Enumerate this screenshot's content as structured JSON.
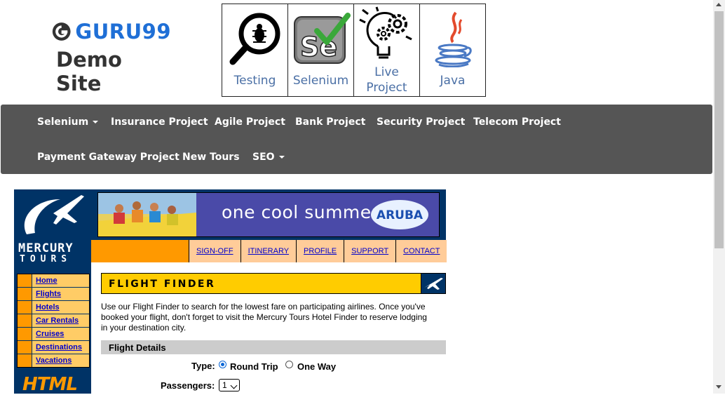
{
  "brand": {
    "name": "GURU99",
    "subtitle": "Demo Site"
  },
  "tiles": [
    {
      "label": "Testing",
      "icon": "magnifier-bug-icon"
    },
    {
      "label": "Selenium",
      "icon": "selenium-icon"
    },
    {
      "label": "Live Project",
      "icon": "lightbulb-gears-icon"
    },
    {
      "label": "Java",
      "icon": "java-cup-icon"
    }
  ],
  "nav": {
    "row1": [
      "Selenium",
      "Insurance Project",
      "Agile Project",
      "Bank Project",
      "Security Project",
      "Telecom Project"
    ],
    "row2": [
      "Payment Gateway Project",
      "New Tours",
      "SEO"
    ]
  },
  "mercury": {
    "logo_name": "MERCURY",
    "logo_sub": "TOURS",
    "banner_text": "one cool summer",
    "banner_brand": "ARUBA",
    "top_links": [
      "SIGN-OFF",
      "ITINERARY",
      "PROFILE",
      "SUPPORT",
      "CONTACT"
    ],
    "side_links": [
      "Home",
      "Flights",
      "Hotels",
      "Car Rentals",
      "Cruises",
      "Destinations",
      "Vacations"
    ],
    "badge": "HTML"
  },
  "flight_finder": {
    "title": "FLIGHT FINDER",
    "description": "Use our Flight Finder to search for the lowest fare on participating airlines. Once you've booked your flight, don't forget to visit the Mercury Tours Hotel Finder to reserve lodging in your destination city.",
    "section_title": "Flight Details",
    "type_label": "Type:",
    "type_options": [
      "Round Trip",
      "One Way"
    ],
    "type_selected": "Round Trip",
    "passengers_label": "Passengers:",
    "passengers_value": "1"
  },
  "colors": {
    "nav_bg": "#555555",
    "brand_blue": "#1f6fd6",
    "mercury_navy": "#003366",
    "mercury_orange": "#ff9900",
    "finder_yellow": "#ffcc00"
  }
}
